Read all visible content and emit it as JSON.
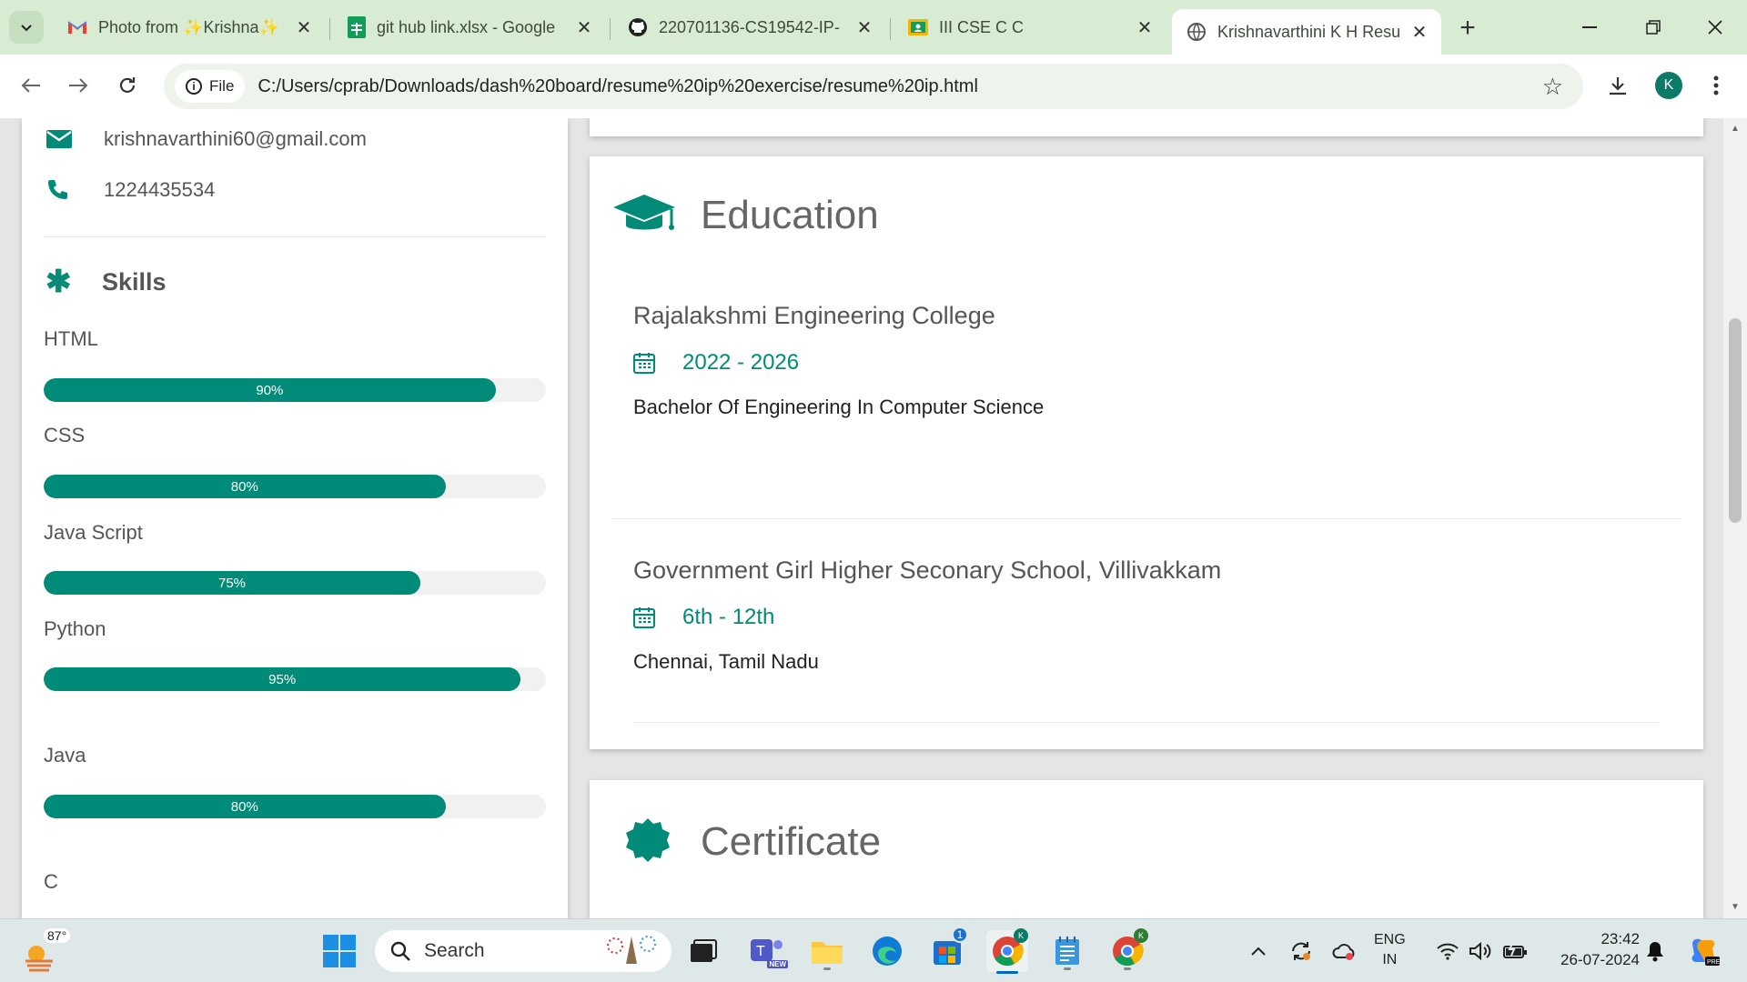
{
  "browser": {
    "tabs": [
      {
        "title": "Photo from ✨Krishna✨",
        "icon": "gmail-icon",
        "active": false
      },
      {
        "title": "git hub link.xlsx - Google",
        "icon": "sheets-icon",
        "active": false
      },
      {
        "title": "220701136-CS19542-IP-",
        "icon": "github-icon",
        "active": false
      },
      {
        "title": "III CSE C C",
        "icon": "classroom-icon",
        "active": false
      },
      {
        "title": "Krishnavarthini K H Resur",
        "icon": "globe-icon",
        "active": true
      }
    ],
    "new_tab_label": "+",
    "file_chip": "File",
    "url": "C:/Users/cprab/Downloads/dash%20board/resume%20ip%20exercise/resume%20ip.html",
    "profile_initial": "K"
  },
  "sidebar": {
    "email": "krishnavarthini60@gmail.com",
    "phone": "1224435534",
    "skills_title": "Skills",
    "skills": [
      {
        "name": "HTML",
        "percent": 90,
        "label": "90%"
      },
      {
        "name": "CSS",
        "percent": 80,
        "label": "80%"
      },
      {
        "name": "Java Script",
        "percent": 75,
        "label": "75%"
      },
      {
        "name": "Python",
        "percent": 95,
        "label": "95%"
      },
      {
        "name": "Java",
        "percent": 80,
        "label": "80%"
      },
      {
        "name": "C"
      }
    ]
  },
  "education": {
    "title": "Education",
    "entries": [
      {
        "school": "Rajalakshmi Engineering College",
        "dates": "2022 - 2026",
        "desc": "Bachelor Of Engineering In Computer Science"
      },
      {
        "school": "Government Girl Higher Seconary School, Villivakkam",
        "dates": "6th - 12th",
        "desc": "Chennai, Tamil Nadu"
      }
    ]
  },
  "certificate": {
    "title": "Certificate"
  },
  "taskbar": {
    "weather_temp": "87°",
    "search_placeholder": "Search",
    "teams_badge": "NEW",
    "store_badge": "1",
    "lang_top": "ENG",
    "lang_bottom": "IN",
    "time": "23:42",
    "date": "26-07-2024"
  },
  "colors": {
    "accent": "#008a78",
    "tab_strip": "#d8ecd3"
  }
}
